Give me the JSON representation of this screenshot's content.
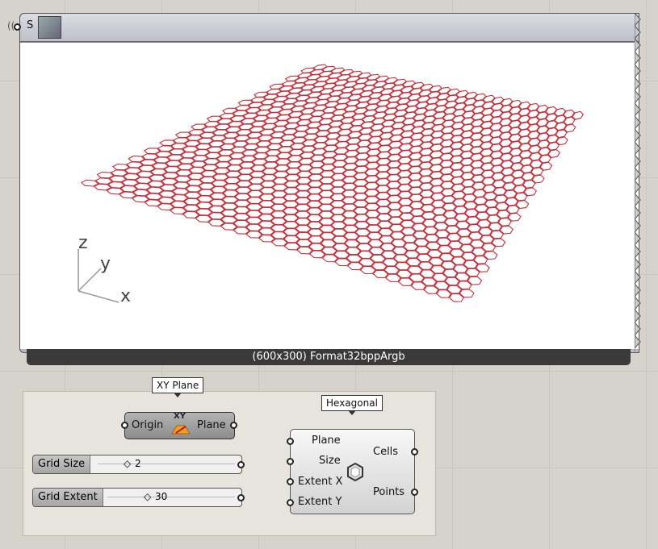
{
  "viewer": {
    "input_label": "S",
    "footer_text": "(600x300) Format32bppArgb",
    "axes": {
      "z": "z",
      "y": "y",
      "x": "x"
    },
    "grid_color": "#c2303b"
  },
  "xy_plane": {
    "tag": "XY Plane",
    "input_label": "Origin",
    "icon_text": "XY",
    "output_label": "Plane"
  },
  "hexagonal": {
    "tag": "Hexagonal",
    "inputs": [
      "Plane",
      "Size",
      "Extent X",
      "Extent Y"
    ],
    "outputs": [
      "Cells",
      "Points"
    ]
  },
  "sliders": {
    "grid_size": {
      "label": "Grid Size",
      "value": "2"
    },
    "grid_extent": {
      "label": "Grid Extent",
      "value": "30"
    }
  }
}
